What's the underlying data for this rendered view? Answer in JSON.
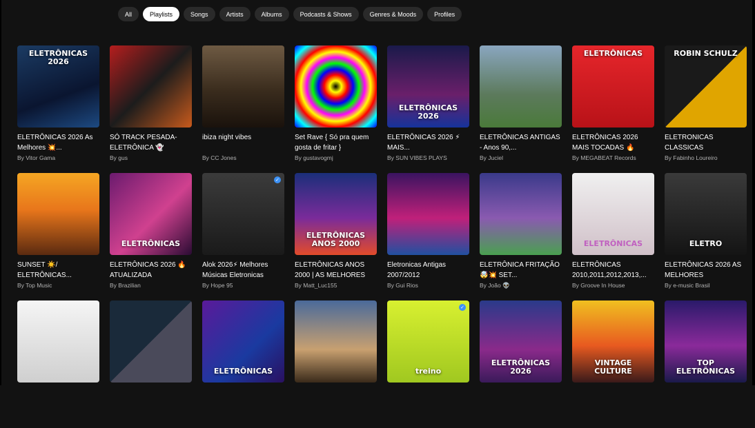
{
  "filters": [
    {
      "label": "All",
      "active": false
    },
    {
      "label": "Playlists",
      "active": true
    },
    {
      "label": "Songs",
      "active": false
    },
    {
      "label": "Artists",
      "active": false
    },
    {
      "label": "Albums",
      "active": false
    },
    {
      "label": "Podcasts & Shows",
      "active": false
    },
    {
      "label": "Genres & Moods",
      "active": false
    },
    {
      "label": "Profiles",
      "active": false
    }
  ],
  "playlists": [
    {
      "title": "ELETRÔNICAS 2026 As Melhores 💥...",
      "author": "By Vitor Gama",
      "cover_text": "ELETRÔNICAS 2026",
      "cover_text_pos": "top",
      "verified": false
    },
    {
      "title": "SÓ TRACK PESADA- ELETRÔNICA 👻",
      "author": "By gus",
      "cover_text": "",
      "verified": false
    },
    {
      "title": "ibiza night vibes",
      "author": "By CC Jones",
      "cover_text": "",
      "verified": false
    },
    {
      "title": "Set Rave { Só pra quem gosta de fritar }",
      "author": "By gustavogmj",
      "cover_text": "",
      "verified": false
    },
    {
      "title": "ELETRÔNICAS 2026 ⚡ MAIS...",
      "author": "By SUN VIBES PLAYS",
      "cover_text": "ELETRÔNICAS 2026",
      "verified": false
    },
    {
      "title": "ELETRÔNICAS ANTIGAS - Anos 90,...",
      "author": "By Juciel",
      "cover_text": "",
      "verified": false
    },
    {
      "title": "ELETRÔNICAS 2026 MAIS TOCADAS 🔥",
      "author": "By MEGABEAT Records",
      "cover_text": "ELETRÔNICAS",
      "cover_text_pos": "top",
      "verified": false
    },
    {
      "title": "ELETRONICAS CLASSICAS",
      "author": "By Fabinho Loureiro",
      "cover_text": "ROBIN SCHULZ",
      "cover_text_pos": "top",
      "verified": false
    },
    {
      "title": "SUNSET ☀️/ ELETRÔNICAS...",
      "author": "By Top Music",
      "cover_text": "",
      "verified": false
    },
    {
      "title": "ELETRÔNICAS 2026 🔥 ATUALIZADA",
      "author": "By Brazilian",
      "cover_text": "ELETRÔNICAS",
      "verified": false
    },
    {
      "title": "Alok 2026⚡ Melhores Músicas Eletronicas",
      "author": "By Hope 95",
      "cover_text": "",
      "verified": true
    },
    {
      "title": "ELETRÔNICAS ANOS 2000 | AS MELHORES",
      "author": "By Matt_Luc155",
      "cover_text": "ELETRÔNICAS ANOS 2000",
      "verified": false
    },
    {
      "title": "Eletronicas Antigas 2007/2012",
      "author": "By Gui Rios",
      "cover_text": "",
      "verified": false
    },
    {
      "title": "ELETRÔNICA FRITAÇÃO 🤯💥 SET...",
      "author": "By João 👽",
      "cover_text": "",
      "verified": false
    },
    {
      "title": "ELETRÔNICAS 2010,2011,2012,2013,...",
      "author": "By Groove In House",
      "cover_text": "ELETRÔNICAS",
      "cover_style": "pink",
      "verified": false
    },
    {
      "title": "ELETRÔNICAS 2026 AS MELHORES",
      "author": "By e-music Brasil",
      "cover_text": "ELETRO",
      "verified": false
    },
    {
      "title": "",
      "author": "",
      "cover_text": "",
      "verified": false
    },
    {
      "title": "",
      "author": "",
      "cover_text": "",
      "verified": false
    },
    {
      "title": "",
      "author": "",
      "cover_text": "ELETRÔNICAS",
      "verified": false
    },
    {
      "title": "",
      "author": "",
      "cover_text": "",
      "verified": false
    },
    {
      "title": "",
      "author": "",
      "cover_text": "treino",
      "verified": true
    },
    {
      "title": "",
      "author": "",
      "cover_text": "ELETRÔNICAS 2026",
      "verified": false
    },
    {
      "title": "",
      "author": "",
      "cover_text": "VINTAGE CULTURE",
      "verified": false
    },
    {
      "title": "",
      "author": "",
      "cover_text": "TOP ELETRÔNICAS",
      "verified": false
    }
  ]
}
